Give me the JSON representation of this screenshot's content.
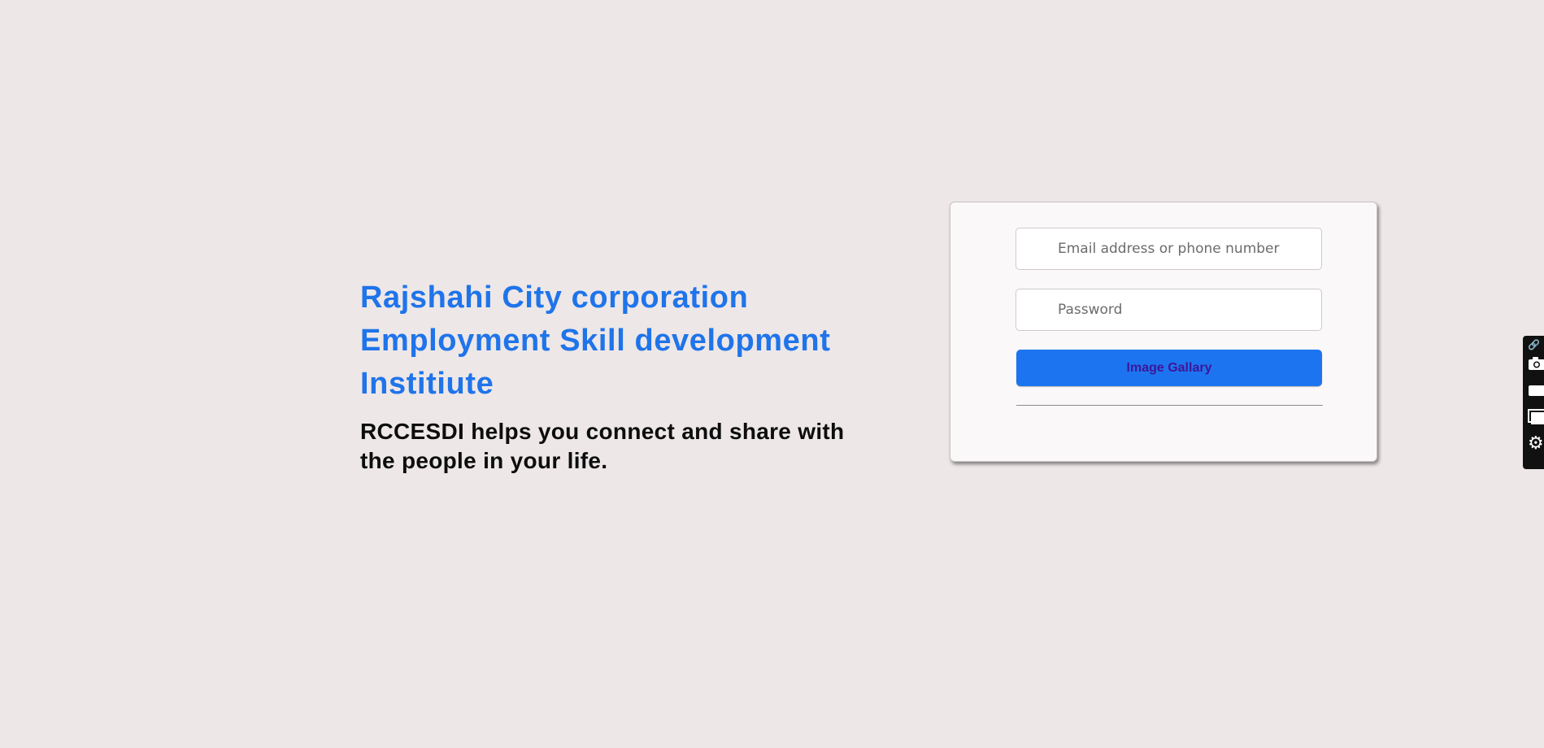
{
  "intro": {
    "title": "Rajshahi City corporation Employment Skill development Institiute",
    "tagline": "RCCESDI helps you connect and share with the people in your life."
  },
  "login": {
    "email_placeholder": "Email address or phone number",
    "password_placeholder": "Password",
    "button_label": "Image Gallary"
  },
  "toolbar": {
    "icons": [
      "link-icon",
      "camera-icon",
      "video-icon",
      "window-icon",
      "gear-icon"
    ]
  },
  "colors": {
    "background": "#ede7e7",
    "title": "#1f74ea",
    "button": "#1d74f0",
    "button_text": "#3f1599",
    "toolbar": "#111111"
  }
}
